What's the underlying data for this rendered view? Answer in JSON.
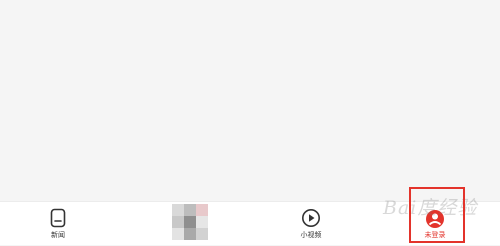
{
  "tabbar": {
    "tabs": [
      {
        "label": "新闻",
        "icon": "news-document-icon"
      },
      {
        "label": "",
        "icon": "pixelated-mosaic-icon"
      },
      {
        "label": "小视频",
        "icon": "play-circle-icon"
      },
      {
        "label": "未登录",
        "icon": "user-profile-icon",
        "highlighted": true
      }
    ]
  },
  "watermark": {
    "text": "Bai度经验"
  },
  "colors": {
    "highlight": "#e3332b",
    "background": "#f5f5f5",
    "tabbar": "#ffffff",
    "label": "#333333"
  }
}
